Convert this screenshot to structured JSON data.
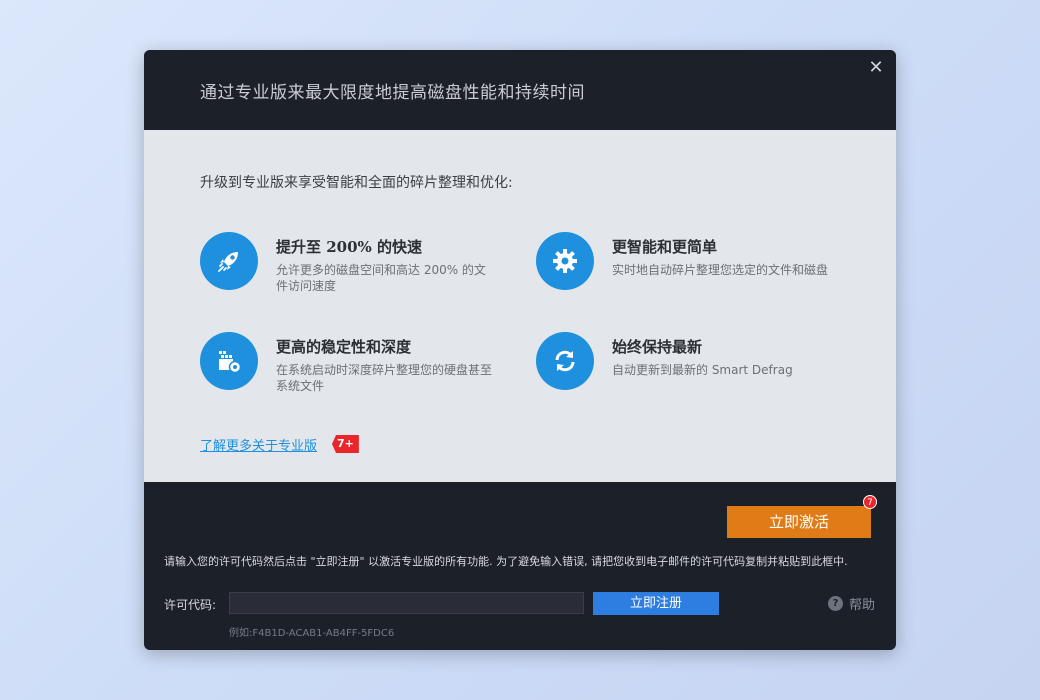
{
  "dialog": {
    "title": "通过专业版来最大限度地提高磁盘性能和持续时间",
    "close_icon": "close-icon",
    "intro": "升级到专业版来享受智能和全面的碎片整理和优化:",
    "features": [
      {
        "icon": "rocket-icon",
        "title": "提升至 200% 的快速",
        "desc": "允许更多的磁盘空间和高达 200% 的文件访问速度"
      },
      {
        "icon": "gear-icon",
        "title": "更智能和更简单",
        "desc": "实时地自动碎片整理您选定的文件和磁盘"
      },
      {
        "icon": "disk-defrag-icon",
        "title": "更高的稳定性和深度",
        "desc": "在系统启动时深度碎片整理您的硬盘甚至系统文件"
      },
      {
        "icon": "refresh-icon",
        "title": "始终保持最新",
        "desc": "自动更新到最新的 Smart Defrag"
      }
    ],
    "learn_more": "了解更多关于专业版",
    "win_badge": "7+",
    "activate_label": "立即激活",
    "activate_badge": "7",
    "hint": "请输入您的许可代码然后点击 \"立即注册\" 以激活专业版的所有功能. 为了避免输入错误, 请把您收到电子邮件的许可代码复制并粘贴到此框中.",
    "license_label": "许可代码:",
    "license_value": "",
    "register_label": "立即注册",
    "help_label": "帮助",
    "example": "例如:F4B1D-ACAB1-AB4FF-5FDC6",
    "colors": {
      "accent": "#1e90dd",
      "activate": "#e07c17",
      "register": "#2e7de0",
      "badge": "#e8262b"
    }
  }
}
